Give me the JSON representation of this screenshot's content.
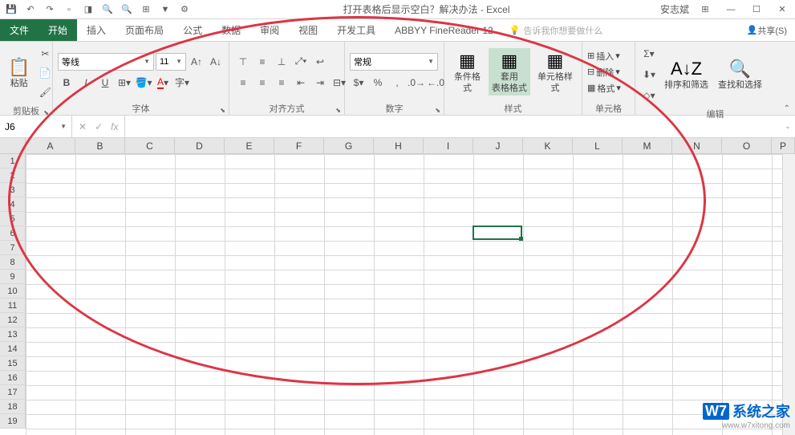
{
  "qat": {
    "save": "💾",
    "undo": "↶",
    "redo": "↷",
    "items": [
      "▫",
      "◨",
      "🔍",
      "🔍",
      "⊞",
      "▼",
      "⚙"
    ]
  },
  "title": "打开表格后显示空白？解决办法 - Excel",
  "user": "安志斌",
  "tabs": {
    "file": "文件",
    "home": "开始",
    "insert": "插入",
    "layout": "页面布局",
    "formulas": "公式",
    "data": "数据",
    "review": "审阅",
    "view": "视图",
    "dev": "开发工具",
    "abbyy": "ABBYY FineReader 12"
  },
  "tellme": "告诉我你想要做什么",
  "share": "共享(S)",
  "ribbon": {
    "clipboard": {
      "paste": "粘贴",
      "label": "剪贴板"
    },
    "font": {
      "name": "等线",
      "size": "11",
      "label": "字体"
    },
    "align": {
      "label": "对齐方式"
    },
    "number": {
      "format": "常规",
      "label": "数字"
    },
    "styles": {
      "cond": "条件格式",
      "table": "套用\n表格格式",
      "cell": "单元格样式",
      "label": "样式"
    },
    "cells": {
      "insert": "插入",
      "delete": "删除",
      "format": "格式",
      "label": "单元格"
    },
    "editing": {
      "sort": "排序和筛选",
      "find": "查找和选择",
      "label": "编辑"
    }
  },
  "nameBox": "J6",
  "columns": [
    "A",
    "B",
    "C",
    "D",
    "E",
    "F",
    "G",
    "H",
    "I",
    "J",
    "K",
    "L",
    "M",
    "N",
    "O",
    "P"
  ],
  "rows": [
    "1",
    "2",
    "3",
    "4",
    "5",
    "6",
    "7",
    "8",
    "9",
    "10",
    "11",
    "12",
    "13",
    "14",
    "15",
    "16",
    "17",
    "18",
    "19"
  ],
  "activeCell": {
    "col": 9,
    "row": 5
  },
  "watermark": {
    "logo": "W7",
    "text": "系统之家",
    "url": "www.w7xitong.com"
  }
}
